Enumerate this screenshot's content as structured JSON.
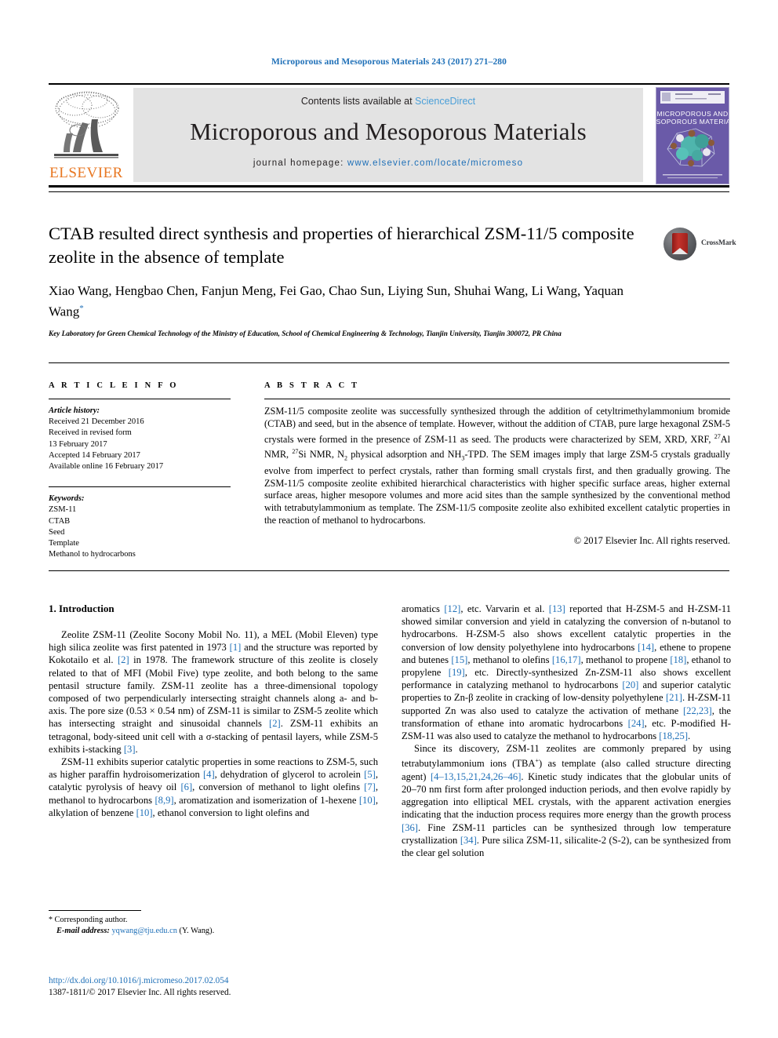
{
  "running_head": "Microporous and Mesoporous Materials 243 (2017) 271–280",
  "banner": {
    "contents_prefix": "Contents lists available at ",
    "sciencedirect": "ScienceDirect",
    "journal_title": "Microporous and Mesoporous Materials",
    "homepage_label": "journal homepage: ",
    "homepage_url": "www.elsevier.com/locate/micromeso",
    "publisher": "ELSEVIER",
    "cover_title_line1": "MICROPOROUS AND",
    "cover_title_line2": "MESOPOROUS MATERIALS",
    "accent_blue": "#1f70b8",
    "sciencedirect_blue": "#4a9fd8",
    "elsevier_orange": "#e87722",
    "banner_gray": "#e3e3e3",
    "cover_purple": "#6a5aa8"
  },
  "article": {
    "title": "CTAB resulted direct synthesis and properties of hierarchical ZSM-11/5 composite zeolite in the absence of template",
    "authors": "Xiao Wang, Hengbao Chen, Fanjun Meng, Fei Gao, Chao Sun, Liying Sun, Shuhai Wang, Li Wang, Yaquan Wang",
    "affiliation": "Key Laboratory for Green Chemical Technology of the Ministry of Education, School of Chemical Engineering & Technology, Tianjin University, Tianjin 300072, PR China",
    "crossmark_label": "CrossMark"
  },
  "article_info": {
    "heading": "A R T I C L E   I N F O",
    "history_label": "Article history:",
    "history": [
      "Received 21 December 2016",
      "Received in revised form",
      "13 February 2017",
      "Accepted 14 February 2017",
      "Available online 16 February 2017"
    ],
    "keywords_label": "Keywords:",
    "keywords": [
      "ZSM-11",
      "CTAB",
      "Seed",
      "Template",
      "Methanol to hydrocarbons"
    ]
  },
  "abstract": {
    "heading": "A B S T R A C T",
    "part1": "ZSM-11/5 composite zeolite was successfully synthesized through the addition of cetyltrimethylammonium bromide (CTAB) and seed, but in the absence of template. However, without the addition of CTAB, pure large hexagonal ZSM-5 crystals were formed in the presence of ZSM-11 as seed. The products were characterized by SEM, XRD, XRF, ",
    "al_sup": "27",
    "al_txt": "Al NMR, ",
    "si_sup": "27",
    "si_txt": "Si NMR, N",
    "n2_sub": "2",
    "part2": " physical adsorption and NH",
    "nh3_sub": "3",
    "part3": "-TPD. The SEM images imply that large ZSM-5 crystals gradually evolve from imperfect to perfect crystals, rather than forming small crystals first, and then gradually growing. The ZSM-11/5 composite zeolite exhibited hierarchical characteristics with higher specific surface areas, higher external surface areas, higher mesopore volumes and more acid sites than the sample synthesized by the conventional method with tetrabutylammonium as template. The ZSM-11/5 composite zeolite also exhibited excellent catalytic properties in the reaction of methanol to hydrocarbons.",
    "copyright": "© 2017 Elsevier Inc. All rights reserved."
  },
  "body": {
    "section_number_title": "1. Introduction",
    "left_paragraphs": [
      "Zeolite ZSM-11 (Zeolite Socony Mobil No. 11), a MEL (Mobil Eleven) type high silica zeolite was first patented in 1973 [1] and the structure was reported by Kokotailo et al. [2] in 1978. The framework structure of this zeolite is closely related to that of MFI (Mobil Five) type zeolite, and both belong to the same pentasil structure family. ZSM-11 zeolite has a three-dimensional topology composed of two perpendicularly intersecting straight channels along a- and b-axis. The pore size (0.53 × 0.54 nm) of ZSM-11 is similar to ZSM-5 zeolite which has intersecting straight and sinusoidal channels [2]. ZSM-11 exhibits an tetragonal, body-siteed unit cell with a σ-stacking of pentasil layers, while ZSM-5 exhibits i-stacking [3].",
      "ZSM-11 exhibits superior catalytic properties in some reactions to ZSM-5, such as higher paraffin hydroisomerization [4], dehydration of glycerol to acrolein [5], catalytic pyrolysis of heavy oil [6], conversion of methanol to light olefins [7], methanol to hydrocarbons [8,9], aromatization and isomerization of 1-hexene [10], alkylation of benzene [10], ethanol conversion to light olefins and"
    ],
    "right_paragraphs": [
      "aromatics [12], etc. Varvarin et al. [13] reported that H-ZSM-5 and H-ZSM-11 showed similar conversion and yield in catalyzing the conversion of n-butanol to hydrocarbons. H-ZSM-5 also shows excellent catalytic properties in the conversion of low density polyethylene into hydrocarbons [14], ethene to propene and butenes [15], methanol to olefins [16,17], methanol to propene [18], ethanol to propylene [19], etc. Directly-synthesized Zn-ZSM-11 also shows excellent performance in catalyzing methanol to hydrocarbons [20] and superior catalytic properties to Zn-β zeolite in cracking of low-density polyethylene [21]. H-ZSM-11 supported Zn was also used to catalyze the activation of methane [22,23], the transformation of ethane into aromatic hydrocarbons [24], etc. P-modified H-ZSM-11 was also used to catalyze the methanol to hydrocarbons [18,25].",
      "Since its discovery, ZSM-11 zeolites are commonly prepared by using tetrabutylammonium ions (TBA+) as template (also called structure directing agent) [4–13,15,21,24,26–46]. Kinetic study indicates that the globular units of 20–70 nm first form after prolonged induction periods, and then evolve rapidly by aggregation into elliptical MEL crystals, with the apparent activation energies indicating that the induction process requires more energy than the growth process [36]. Fine ZSM-11 particles can be synthesized through low temperature crystallization [34]. Pure silica ZSM-11, silicalite-2 (S-2), can be synthesized from the clear gel solution"
    ]
  },
  "footer": {
    "corresponding_author": "Corresponding author.",
    "email_label": "E-mail address:",
    "email": "yqwang@tju.edu.cn",
    "email_owner": "(Y. Wang).",
    "doi": "http://dx.doi.org/10.1016/j.micromeso.2017.02.054",
    "issn_line": "1387-1811/© 2017 Elsevier Inc. All rights reserved."
  }
}
